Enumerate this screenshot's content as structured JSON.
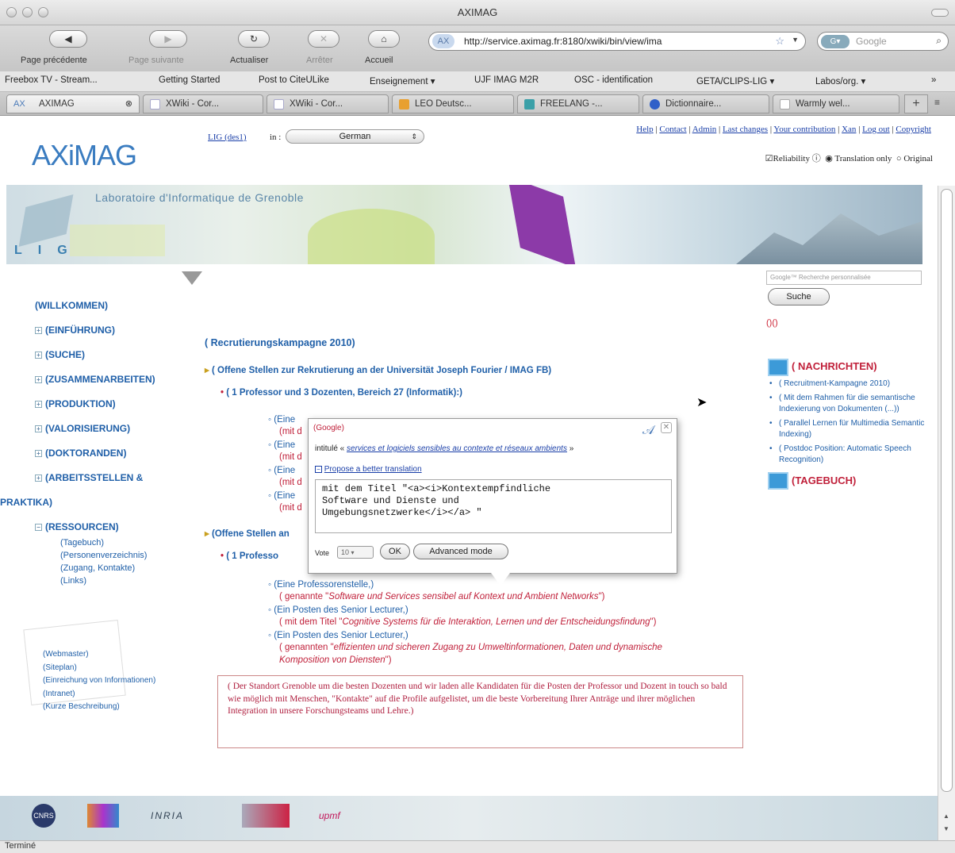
{
  "window": {
    "title": "AXIMAG"
  },
  "toolbar": {
    "back_label": "Page précédente",
    "forward_label": "Page suivante",
    "reload_label": "Actualiser",
    "stop_label": "Arrêter",
    "home_label": "Accueil",
    "url": "http://service.aximag.fr:8180/xwiki/bin/view/ima",
    "search_placeholder": "Google"
  },
  "bookmarks": [
    "Freebox TV - Stream...",
    "Getting Started",
    "Post to CiteULike",
    "Enseignement ▾",
    "UJF IMAG M2R",
    "OSC - identification",
    "GETA/CLIPS-LIG ▾",
    "Labos/org. ▾",
    "»"
  ],
  "tabs": [
    {
      "label": "AXIMAG",
      "active": true
    },
    {
      "label": "XWiki - Cor...",
      "active": false
    },
    {
      "label": "XWiki - Cor...",
      "active": false
    },
    {
      "label": "LEO Deutsc...",
      "active": false
    },
    {
      "label": "FREELANG -...",
      "active": false
    },
    {
      "label": "Dictionnaire...",
      "active": false
    },
    {
      "label": "Warmly wel...",
      "active": false
    }
  ],
  "header": {
    "logo": "AXiMAG",
    "lig_link": "LIG (des1)",
    "in_label": "in :",
    "language": "German",
    "top_links": [
      "Help",
      "Contact",
      "Admin",
      "Last changes",
      "Your contribution",
      "Xan",
      "Log out",
      "Copyright"
    ],
    "mode_reliability": "Reliability",
    "mode_translation": "Translation only",
    "mode_original": "Original"
  },
  "banner": {
    "title": "Laboratoire d'Informatique de Grenoble",
    "lig": "LIG"
  },
  "search": {
    "placeholder": "Google™ Recherche personnalisée",
    "button": "Suche",
    "pager": "()()"
  },
  "leftnav": {
    "items": [
      "(WILLKOMMEN)",
      "(EINFÜHRUNG)",
      "(SUCHE)",
      "(ZUSAMMENARBEITEN)",
      "(PRODUKTION)",
      "(VALORISIERUNG)",
      "(DOKTORANDEN)",
      "(ARBEITSSTELLEN &",
      "PRAKTIKA)",
      "(RESSOURCEN)"
    ],
    "sub": [
      "(Tagebuch)",
      "(Personenverzeichnis)",
      "(Zugang, Kontakte)",
      "(Links)"
    ]
  },
  "footer_links": [
    "(Webmaster)",
    "(Siteplan)",
    "(Einreichung von Informationen)",
    "(Intranet)",
    "(Kurze Beschreibung)"
  ],
  "main": {
    "heading": "( Recrutierungskampagne 2010)",
    "section1": "( Offene Stellen zur Rekrutierung an der Universität Joseph Fourier / IMAG FB)",
    "sub1": "( 1 Professor und 3 Dozenten, Bereich 27 (Informatik):)",
    "b1": "(Eine",
    "b1b": "(mit d",
    "b2": "(Eine",
    "b2b": "(mit d",
    "b3": "(Eine",
    "b3b": "(mit d",
    "b4": "(Eine",
    "b4b": "(mit d",
    "section2": "(Offene Stellen an",
    "sub2": "( 1 Professo",
    "c1": "(Eine Professorenstelle,)",
    "c1b_prefix": "( genannte \"",
    "c1b_italic": "Software und Services sensibel auf Kontext und Ambient Networks",
    "c1b_suffix": "\")",
    "c2": "(Ein Posten des Senior Lecturer,)",
    "c2b_prefix": "( mit dem Titel \"",
    "c2b_italic": "Cognitive Systems für die Interaktion, Lernen und der Entscheidungsfindung",
    "c2b_suffix": "\")",
    "c3": "(Ein Posten des Senior Lecturer,)",
    "c3b_prefix": "( genannten \"",
    "c3b_italic": "effizienten und sicheren Zugang zu Umweltinformationen, Daten und dynamische",
    "c3c_italic": "Komposition von Diensten",
    "c3c_suffix": "\")",
    "note": "( Der Standort Grenoble um die besten Dozenten und wir laden alle Kandidaten für die Posten der Professor und Dozent in touch so bald wie möglich mit Menschen, \"Kontakte\" auf die Profile aufgelistet, um die beste Vorbereitung Ihrer Anträge und ihrer möglichen Integration in unsere Forschungsteams und Lehre.)"
  },
  "rightcol": {
    "news_title": "( NACHRICHTEN)",
    "news": [
      "( Recruitment-Kampagne 2010)",
      "( Mit dem Rahmen für die semantische Indexierung von Dokumenten (...))",
      "( Parallel Lernen für Multimedia Semantic Indexing)",
      "( Postdoc Position: Automatic Speech Recognition)"
    ],
    "diary_title": "(TAGEBUCH)"
  },
  "popup": {
    "title": "(Google)",
    "src_prefix": "intitulé «",
    "src_link": "services et logiciels sensibles au contexte et réseaux ambients",
    "src_suffix": "»",
    "propose": "Propose a better translation",
    "text": "mit dem Titel \"<a><i>Kontextempfindliche\nSoftware und Dienste und\nUmgebungsnetzwerke</i></a> \"",
    "vote_label": "Vote",
    "vote_value": "10",
    "ok": "OK",
    "advanced": "Advanced mode"
  },
  "partners": [
    "CNRS",
    "INRIA",
    "upmf"
  ],
  "status": "Terminé"
}
